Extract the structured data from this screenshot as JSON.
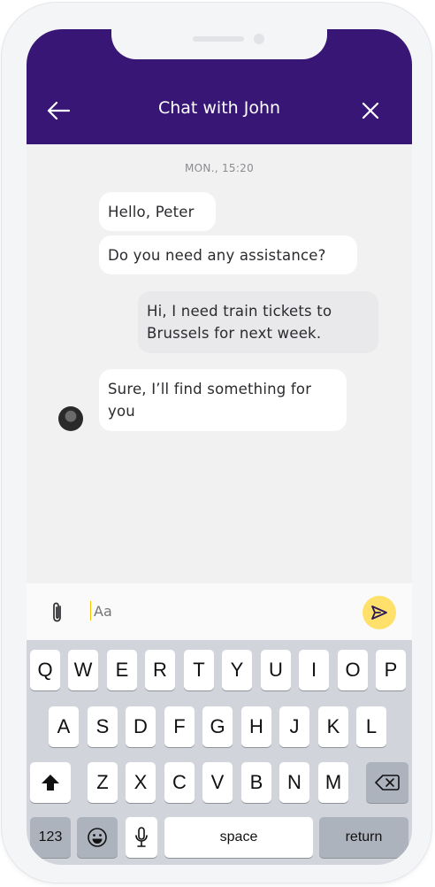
{
  "header": {
    "title": "Chat with John",
    "back_icon": "arrow-left-icon",
    "close_icon": "close-icon",
    "bg": "#381676"
  },
  "chat": {
    "timestamp": "MON., 15:20",
    "messages": [
      {
        "from": "agent",
        "text": "Hello, Peter"
      },
      {
        "from": "agent",
        "text": "Do you need any assistance?"
      },
      {
        "from": "user",
        "text_lines": [
          "Hi, I need train tickets to",
          "Brussels for next week."
        ]
      },
      {
        "from": "agent",
        "text_lines": [
          "Sure, I’ll find something for",
          "you"
        ]
      }
    ]
  },
  "composer": {
    "placeholder": "Aa",
    "attach_icon": "paperclip-icon",
    "send_icon": "send-icon",
    "send_bg": "#ffe06b"
  },
  "keyboard": {
    "row1": [
      "Q",
      "W",
      "E",
      "R",
      "T",
      "Y",
      "U",
      "I",
      "O",
      "P"
    ],
    "row2": [
      "A",
      "S",
      "D",
      "F",
      "G",
      "H",
      "J",
      "K",
      "L"
    ],
    "row3": [
      "Z",
      "X",
      "C",
      "V",
      "B",
      "N",
      "M"
    ],
    "numbers": "123",
    "space": "space",
    "return": "return"
  }
}
